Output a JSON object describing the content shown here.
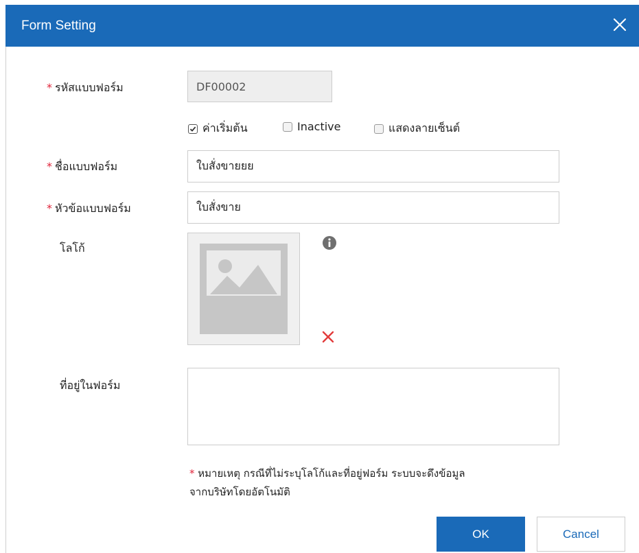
{
  "dialog": {
    "title": "Form Setting",
    "close_icon": "close-icon",
    "header_color": "#1a6ab8"
  },
  "form": {
    "code": {
      "label": "รหัสแบบฟอร์ม",
      "value": "DF00002",
      "required": "*"
    },
    "checkboxes": [
      {
        "label": "ค่าเริ่มต้น",
        "checked": true
      },
      {
        "label": "Inactive",
        "checked": false
      },
      {
        "label": "แสดงลายเซ็นต์",
        "checked": false
      }
    ],
    "name": {
      "label": "ชื่อแบบฟอร์ม",
      "value": "ใบสั่งขายยย",
      "required": "*"
    },
    "heading": {
      "label": "หัวข้อแบบฟอร์ม",
      "value": "ใบสั่งขาย",
      "required": "*"
    },
    "logo": {
      "label": "โลโก้",
      "placeholder_icon": "image-placeholder-icon",
      "info_icon": "info-icon",
      "remove_icon": "remove-icon"
    },
    "address": {
      "label": "ที่อยู่ในฟอร์ม",
      "value": ""
    },
    "note": {
      "marker": "*",
      "line1": "หมายเหตุ กรณีที่ไม่ระบุโลโก้และที่อยู่ฟอร์ม ระบบจะดึงข้อมูล",
      "line2": "จากบริษัทโดยอัตโนมัติ"
    }
  },
  "buttons": {
    "ok": "OK",
    "cancel": "Cancel"
  }
}
